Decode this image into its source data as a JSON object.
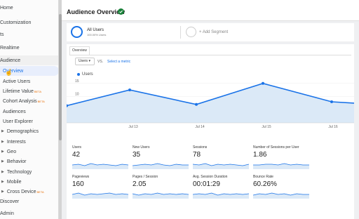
{
  "colors": {
    "accent": "#1a73e8",
    "area": "#dbe9f7",
    "active_bg": "#e8eefc",
    "beta": "#e8710a"
  },
  "sidebar": {
    "items": [
      {
        "label": "Home",
        "kind": "top"
      },
      {
        "label": "Customization",
        "kind": "top"
      },
      {
        "label": "ts",
        "kind": "top"
      },
      {
        "label": "Realtime",
        "kind": "top"
      },
      {
        "label": "Audience",
        "kind": "section"
      },
      {
        "label": "Overview",
        "kind": "active"
      },
      {
        "label": "Active Users",
        "kind": "sub"
      },
      {
        "label": "Lifetime Value",
        "kind": "sub",
        "badge": "BETA"
      },
      {
        "label": "Cohort Analysis",
        "kind": "sub",
        "badge": "BETA"
      },
      {
        "label": "Audiences",
        "kind": "sub"
      },
      {
        "label": "User Explorer",
        "kind": "sub"
      },
      {
        "label": "Demographics",
        "kind": "group"
      },
      {
        "label": "Interests",
        "kind": "group"
      },
      {
        "label": "Geo",
        "kind": "group"
      },
      {
        "label": "Behavior",
        "kind": "group"
      },
      {
        "label": "Technology",
        "kind": "group"
      },
      {
        "label": "Mobile",
        "kind": "group"
      },
      {
        "label": "Cross Device",
        "kind": "group",
        "badge": "BETA"
      },
      {
        "label": "Discover",
        "kind": "top"
      },
      {
        "label": "Admin",
        "kind": "top"
      }
    ]
  },
  "header": {
    "title": "Audience Overview",
    "verified_icon": "check-circle-icon"
  },
  "segments": {
    "primary_name": "All Users",
    "primary_sub": "100.00% Users",
    "add_label": "+ Add Segment"
  },
  "overview": {
    "tab_label": "Overview",
    "metric_select": "Users ▾",
    "vs": "VS.",
    "select_metric": "Select a metric",
    "legend": "Users"
  },
  "chart_data": {
    "type": "area",
    "series": [
      {
        "name": "Users",
        "values": [
          6.5,
          12.5,
          7,
          15,
          8,
          7.5
        ]
      }
    ],
    "x": [
      0,
      1,
      2,
      3,
      4,
      5
    ],
    "x_tick_labels": [
      "Jul 13",
      "Jul 14",
      "Jul 15",
      "Jul 16"
    ],
    "y_tick_labels": [
      "15",
      "10",
      "5"
    ],
    "ylim": [
      0,
      16
    ]
  },
  "metrics": [
    {
      "label": "Users",
      "value": "42"
    },
    {
      "label": "New Users",
      "value": "35"
    },
    {
      "label": "Sessions",
      "value": "78"
    },
    {
      "label": "Number of Sessions per User",
      "value": "1.86"
    },
    {
      "label": "Pageviews",
      "value": "160"
    },
    {
      "label": "Pages / Session",
      "value": "2.05"
    },
    {
      "label": "Avg. Session Duration",
      "value": "00:01:29"
    },
    {
      "label": "Bounce Rate",
      "value": "60.26%"
    }
  ]
}
